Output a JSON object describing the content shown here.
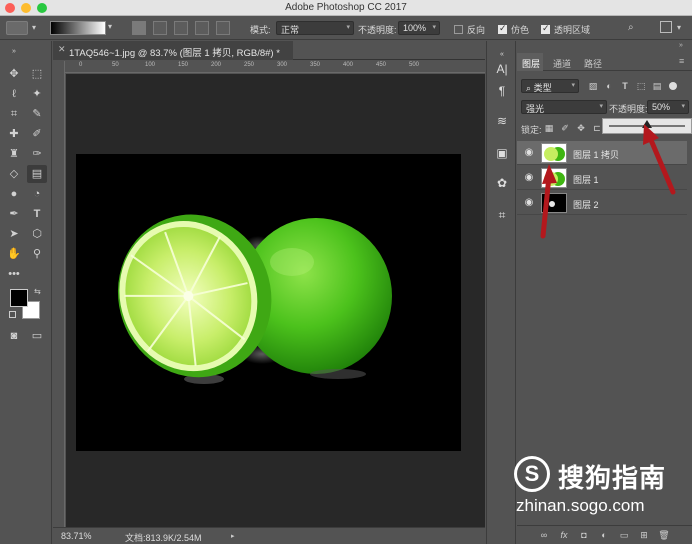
{
  "window": {
    "title": "Adobe Photoshop CC 2017"
  },
  "options_bar": {
    "mode_label": "模式:",
    "mode_value": "正常",
    "opacity_label": "不透明度:",
    "opacity_value": "100%",
    "reverse_label": "反向",
    "dither_label": "仿色",
    "transparency_label": "透明区域",
    "reverse_checked": false,
    "dither_checked": true,
    "transparency_checked": true
  },
  "document": {
    "tab_title": "1TAQ546~1.jpg @ 83.7% (图层 1 拷贝, RGB/8#) *",
    "ruler_ticks": [
      "0",
      "50",
      "100",
      "150",
      "200",
      "250",
      "300",
      "350",
      "400",
      "450",
      "500"
    ]
  },
  "status": {
    "zoom": "83.71%",
    "doc_info": "文档:813.9K/2.54M"
  },
  "panel": {
    "tabs": [
      "图层",
      "通道",
      "路径"
    ],
    "filter_label": "类型",
    "blend_mode": "强光",
    "opacity_label": "不透明度:",
    "opacity_value": "50%",
    "opacity_fraction": 0.5,
    "lock_label": "锁定:",
    "layers": [
      {
        "name": "图层 1 拷贝",
        "selected": true
      },
      {
        "name": "图层 1",
        "selected": false
      },
      {
        "name": "图层 2",
        "selected": false
      }
    ]
  },
  "watermark": {
    "brand": "搜狗指南",
    "url": "zhinan.sogo.com"
  },
  "colors": {
    "accent_arrow": "#b3181d",
    "lime": "#4ec21a",
    "lime_light": "#c8f06a"
  }
}
